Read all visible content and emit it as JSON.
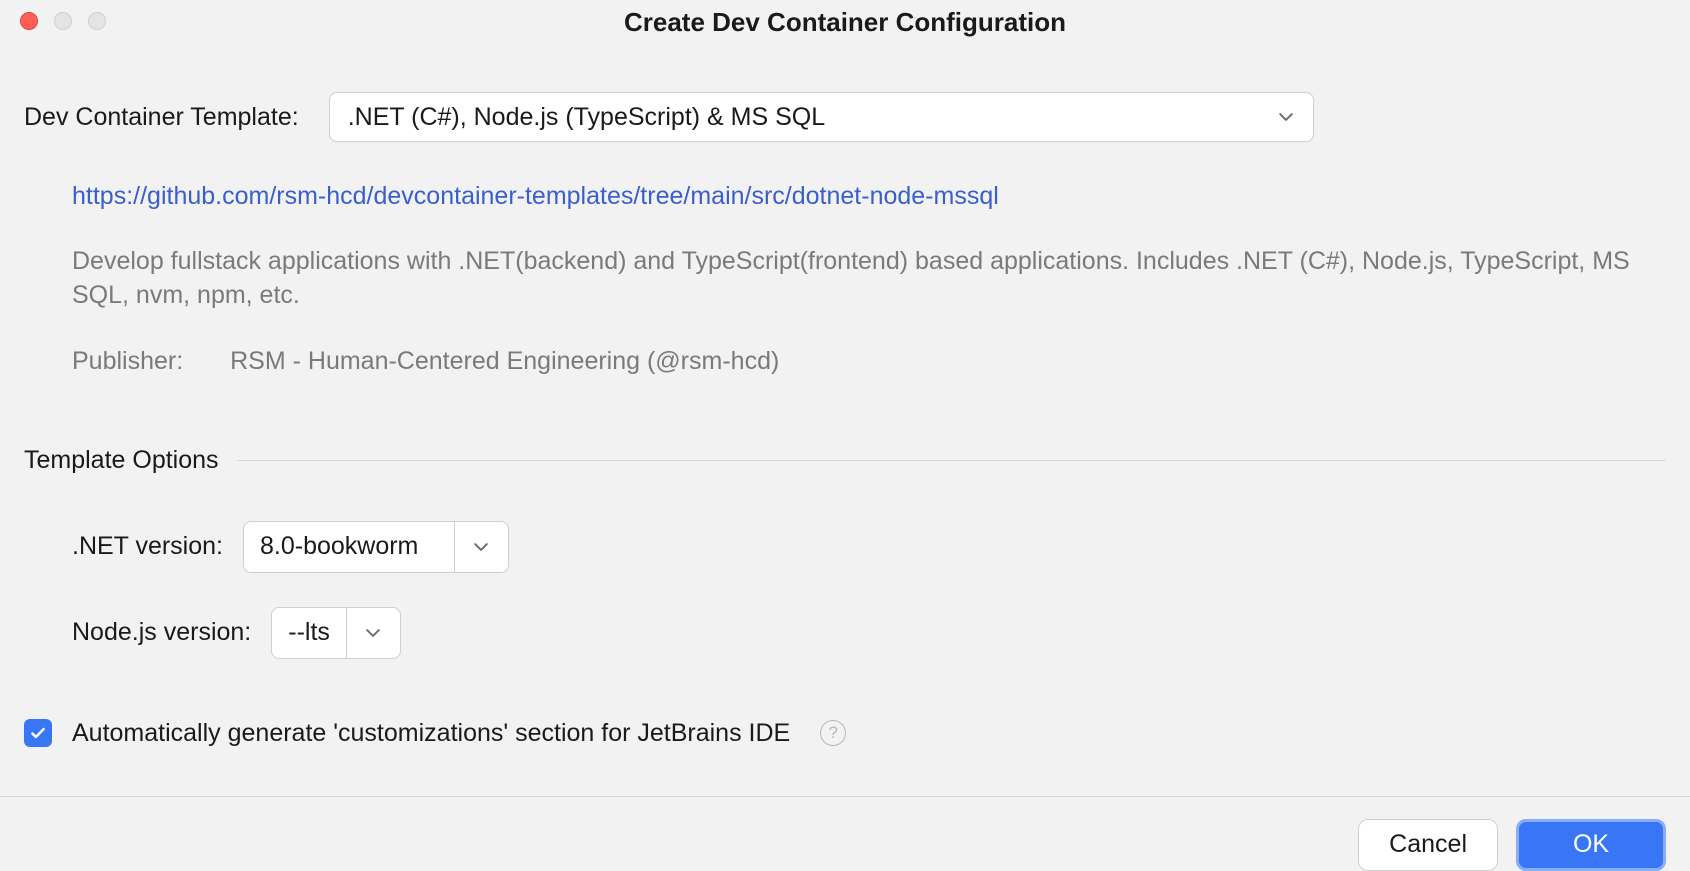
{
  "window": {
    "title": "Create Dev Container Configuration"
  },
  "template": {
    "label": "Dev Container Template:",
    "selected": ".NET (C#), Node.js (TypeScript) & MS SQL"
  },
  "info": {
    "link": "https://github.com/rsm-hcd/devcontainer-templates/tree/main/src/dotnet-node-mssql",
    "description": "Develop fullstack applications with .NET(backend) and TypeScript(frontend) based applications. Includes .NET (C#), Node.js, TypeScript, MS SQL, nvm, npm, etc.",
    "publisher_label": "Publisher:",
    "publisher_value": "RSM - Human-Centered Engineering (@rsm-hcd)"
  },
  "options": {
    "section_title": "Template Options",
    "dotnet_label": ".NET version:",
    "dotnet_value": "8.0-bookworm",
    "node_label": "Node.js version:",
    "node_value": "--lts"
  },
  "checkbox": {
    "label": "Automatically generate 'customizations' section for JetBrains IDE"
  },
  "buttons": {
    "cancel": "Cancel",
    "ok": "OK"
  }
}
